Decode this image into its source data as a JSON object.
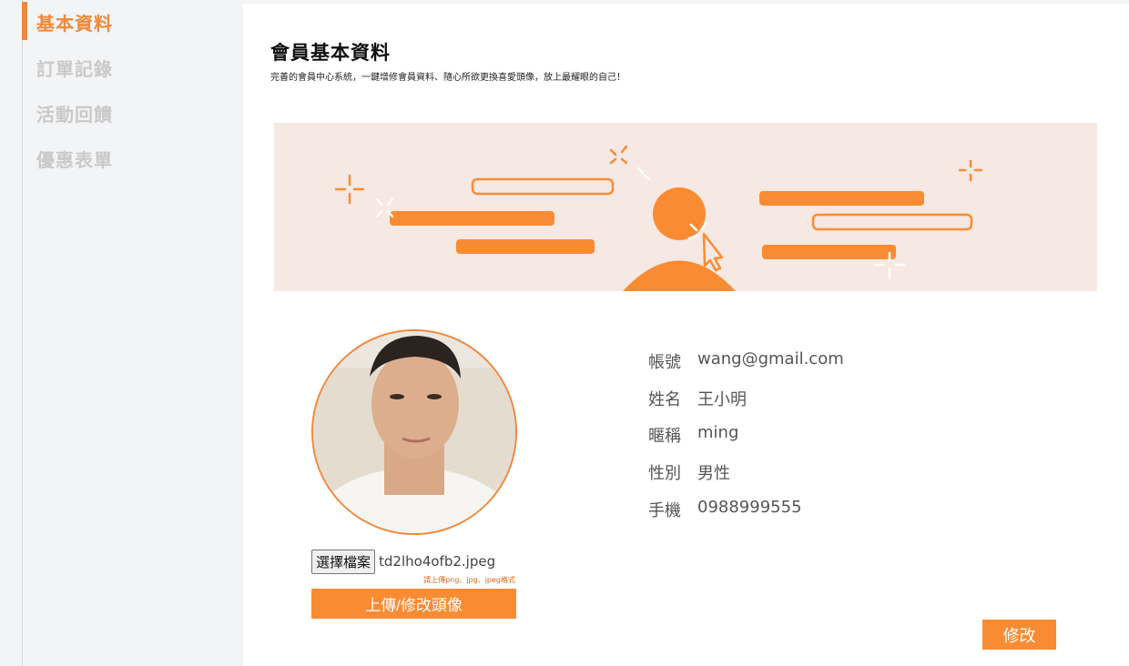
{
  "sidebar": {
    "items": [
      {
        "label": "基本資料",
        "active": true
      },
      {
        "label": "訂單記錄",
        "active": false
      },
      {
        "label": "活動回饋",
        "active": false
      },
      {
        "label": "優惠表單",
        "active": false
      }
    ]
  },
  "main": {
    "title": "會員基本資料",
    "subtitle": "完善的會員中心系統，一鍵增修會員資料、隨心所欲更換喜愛頭像，放上最耀眼的自己！"
  },
  "avatar": {
    "file_button": "選擇檔案",
    "file_name": "td2lho4ofb2.jpeg",
    "hint": "請上傳png、jpg、jpeg格式",
    "upload_button": "上傳/修改頭像"
  },
  "profile": {
    "account": {
      "label": "帳號",
      "value": "wang@gmail.com"
    },
    "name": {
      "label": "姓名",
      "value": "王小明"
    },
    "nickname": {
      "label": "暱稱",
      "value": "ming"
    },
    "gender": {
      "label": "性別",
      "value": "男性"
    },
    "phone": {
      "label": "手機",
      "value": "0988999555"
    }
  },
  "edit_button": "修改",
  "colors": {
    "accent": "#f98c33",
    "active_nav": "#f0883a",
    "banner_bg": "#f6e8e2"
  }
}
